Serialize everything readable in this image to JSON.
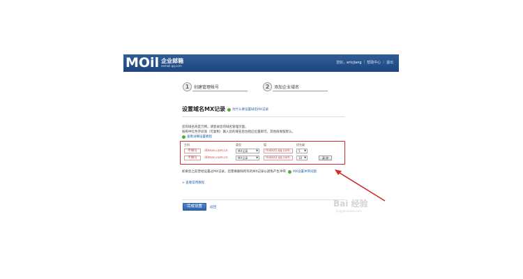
{
  "header": {
    "logo_mark": "MOil",
    "logo_title": "企业邮箱",
    "logo_sub": "exmail.qq.com",
    "greeting": "您好，",
    "username": "ericjiang",
    "sep": "|",
    "help_center": "帮助中心",
    "logout": "退出"
  },
  "steps": [
    {
      "num": "1",
      "label": "创建管理帐号"
    },
    {
      "num": "2",
      "label": "添加企业域名"
    }
  ],
  "page": {
    "title": "设置域名MX记录",
    "title_help": "为什么要设置域名MX记录"
  },
  "instructions": {
    "line1": "您的域名商是万网，请登录您的域名管理页面，",
    "line2": "按照中红色字段值（可复制）输入您的域名后台相应位置即可。其他值保留默认。",
    "detail_link": "查看详细设置教程"
  },
  "table": {
    "headers": {
      "host": "主机",
      "type": "类型",
      "value": "值",
      "priority": "优先级"
    },
    "rows": [
      {
        "host": "不填写",
        "domain": ".ll0man.com.cn",
        "type": "MX记录",
        "value": "mxbiz1.qq.com.",
        "priority": "5"
      },
      {
        "host": "不填写",
        "domain": ".ll0man.com.cn",
        "type": "MX记录",
        "value": "mxbiz2.qq.com.",
        "priority": "10"
      }
    ],
    "delete_label": "清 除"
  },
  "notes": {
    "mx_notice": "如果您之前曾经设置过MX记录，您需要删除所有的MX记录以避免产生冲突",
    "mx_notice_link": "MX设置冲突问题",
    "faq_link": "查看常用教程"
  },
  "actions": {
    "finish": "完成设置",
    "back": "返回"
  },
  "watermark": {
    "main": "Bai 经验",
    "sub": "jingyan.baidu.com"
  },
  "colors": {
    "header_bg": "#2f5c97",
    "highlight_red": "#d12a2a",
    "link_blue": "#2a5fae",
    "button_blue": "#3a70b8"
  }
}
